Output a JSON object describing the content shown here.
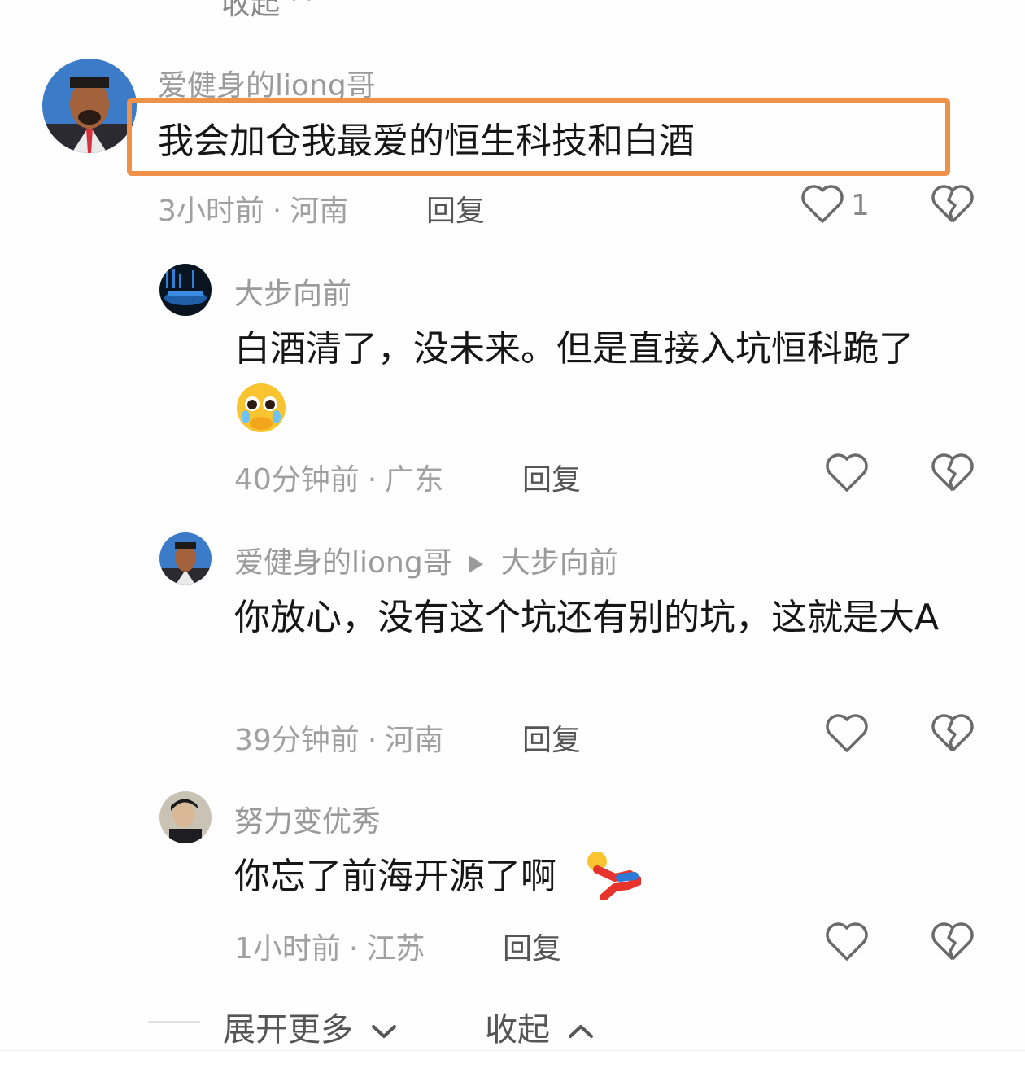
{
  "top": {
    "collapse_label": "收起 ^"
  },
  "main_comment": {
    "username": "爱健身的liong哥",
    "text": "我会加仓我最爱的恒生科技和白酒",
    "time": "3小时前",
    "location": "河南",
    "reply_label": "回复",
    "like_count": "1"
  },
  "replies": [
    {
      "username": "大步向前",
      "text": "白酒清了，没未来。但是直接入坑恒科跪了",
      "emoji": "pleading-face-emoji",
      "time": "40分钟前",
      "location": "广东",
      "reply_label": "回复"
    },
    {
      "username": "爱健身的liong哥",
      "reply_to": "大步向前",
      "text": "你放心，没有这个坑还有别的坑，这就是大A",
      "time": "39分钟前",
      "location": "河南",
      "reply_label": "回复"
    },
    {
      "username": "努力变优秀",
      "text": "你忘了前海开源了啊",
      "emoji": "falling-person-emoji",
      "time": "1小时前",
      "location": "江苏",
      "reply_label": "回复"
    }
  ],
  "footer": {
    "expand_label": "展开更多",
    "collapse_label": "收起"
  },
  "colors": {
    "highlight_border": "#f0914a",
    "meta_text": "#a0a0a0",
    "username_text": "#9a9a9a"
  },
  "separator": "·"
}
